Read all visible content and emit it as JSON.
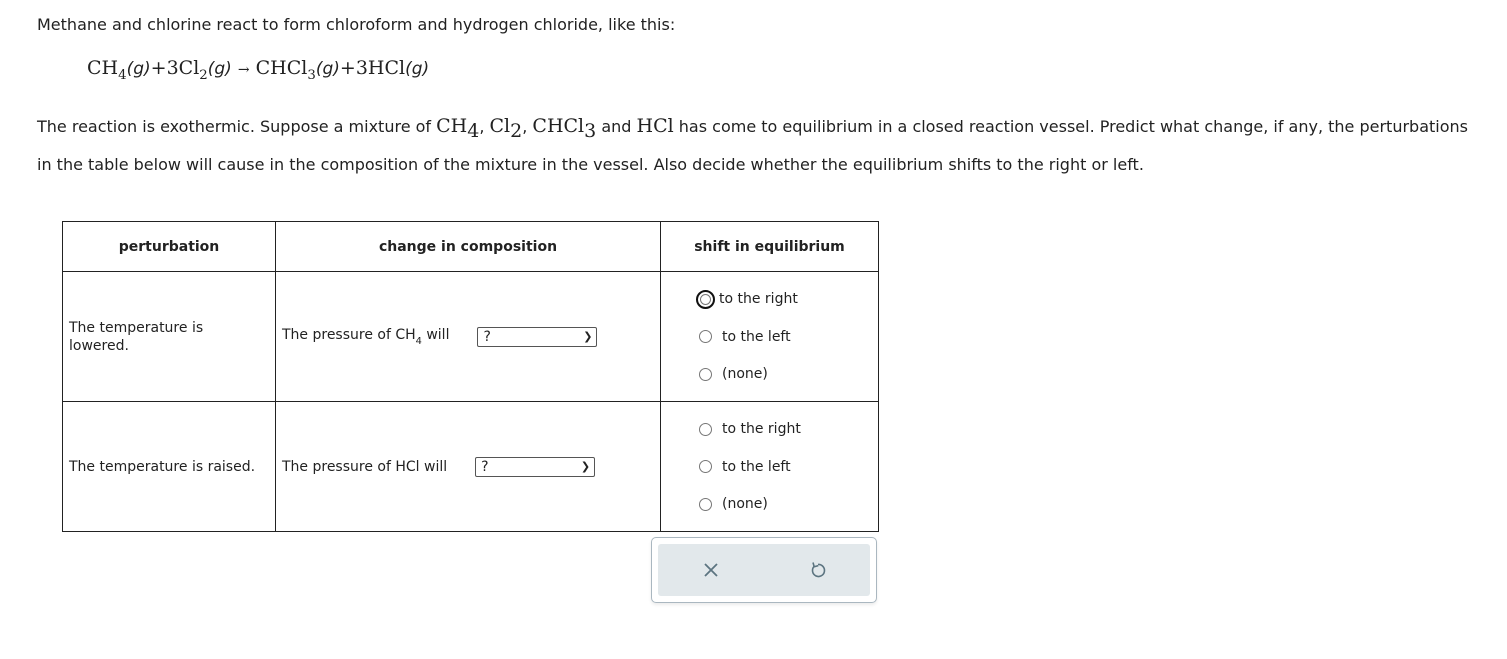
{
  "intro": "Methane and chlorine react to form chloroform and hydrogen chloride, like this:",
  "equation": {
    "r1": "CH",
    "r1sub": "4",
    "state": "(g)",
    "plus": "+",
    "r2": "3Cl",
    "r2sub": "2",
    "arrow": "→",
    "p1": "CHCl",
    "p1sub": "3",
    "p2": "3HCl"
  },
  "paragraph": {
    "a": "The reaction is exothermic. Suppose a mixture of ",
    "ch4": "CH",
    "ch4sub": "4",
    "sep": ", ",
    "cl2": "Cl",
    "cl2sub": "2",
    "chcl3": "CHCl",
    "chcl3sub": "3",
    "and": " and ",
    "hcl": "HCl",
    "b": " has come to equilibrium in a closed reaction vessel. Predict what change, if any, the perturbations in the table below will cause in the composition of the mixture in the vessel. Also decide whether the equilibrium shifts to the right or left."
  },
  "table": {
    "headers": [
      "perturbation",
      "change in composition",
      "shift in equilibrium"
    ],
    "rows": [
      {
        "perturbation": "The temperature is lowered.",
        "comp_pre": "The pressure of CH",
        "comp_sub": "4",
        "comp_post": " will",
        "select": "?",
        "options": [
          "to the right",
          "to the left",
          "(none)"
        ]
      },
      {
        "perturbation": "The temperature is raised.",
        "comp_pre": "The pressure of HCl will",
        "comp_sub": "",
        "comp_post": "",
        "select": "?",
        "options": [
          "to the right",
          "to the left",
          "(none)"
        ]
      }
    ]
  },
  "buttons": {
    "clear_icon": "x-icon",
    "reset_icon": "undo-icon"
  },
  "colors": {
    "panel_bg": "#e2e8eb",
    "icon": "#5c7480"
  }
}
